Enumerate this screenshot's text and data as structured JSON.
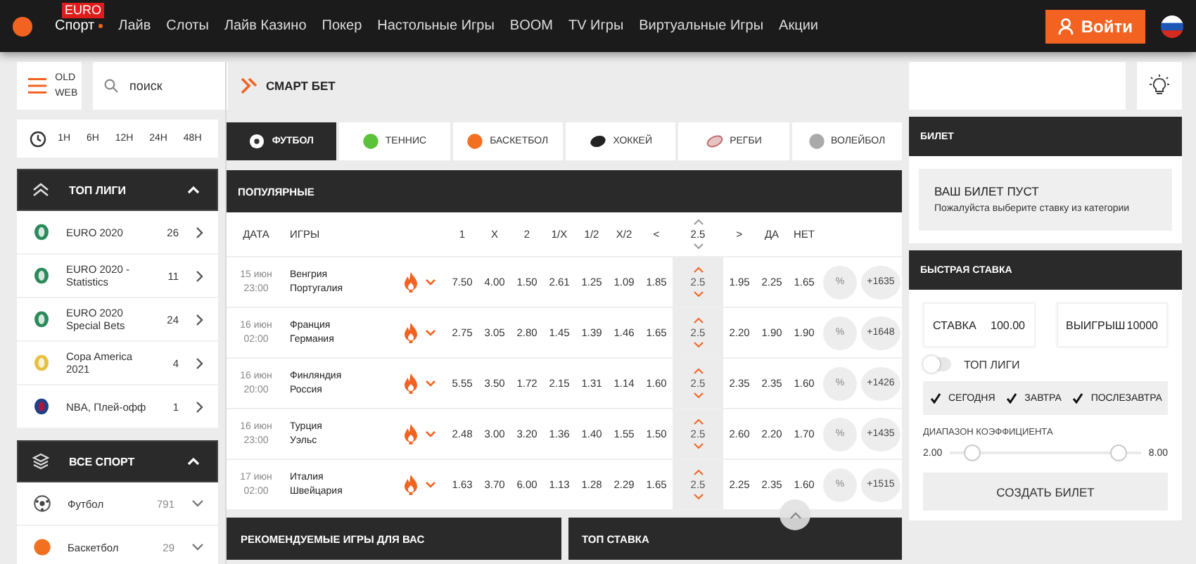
{
  "nav": {
    "badge": "EURO",
    "items": [
      {
        "label": "Спорт",
        "selected": true
      },
      {
        "label": "Лайв",
        "selected": false
      },
      {
        "label": "Слоты",
        "selected": false
      },
      {
        "label": "Лайв Казино",
        "selected": false
      },
      {
        "label": "Покер",
        "selected": false
      },
      {
        "label": "Настольные Игры",
        "selected": false
      },
      {
        "label": "BOOM",
        "selected": false
      },
      {
        "label": "TV Игры",
        "selected": false
      },
      {
        "label": "Виртуальные Игры",
        "selected": false
      },
      {
        "label": "Акции",
        "selected": false
      }
    ],
    "login": "Войти"
  },
  "left": {
    "old_web": "OLD WEB",
    "search": {
      "placeholder": "поиск"
    },
    "time_filters": [
      "1H",
      "6H",
      "12H",
      "24H",
      "48H"
    ],
    "top_leagues": {
      "title": "ТОП ЛИГИ",
      "expanded": true,
      "items": [
        {
          "name": "EURO 2020",
          "count": "26",
          "kind": "euro"
        },
        {
          "name": "EURO 2020 - Statistics",
          "count": "11",
          "kind": "euro"
        },
        {
          "name": "EURO 2020 Special Bets",
          "count": "24",
          "kind": "euro"
        },
        {
          "name": "Copa America 2021",
          "count": "4",
          "kind": "copa"
        },
        {
          "name": "NBA, Плей-офф",
          "count": "1",
          "kind": "nba"
        }
      ]
    },
    "all_sports": {
      "title": "ВСЕ СПОРТ",
      "expanded": true,
      "items": [
        {
          "name": "Футбол",
          "count": "791",
          "kind": "football"
        },
        {
          "name": "Баскетбол",
          "count": "29",
          "kind": "basketball"
        }
      ]
    }
  },
  "main": {
    "smart_bet": "СМАРТ БЕТ",
    "sport_tabs": [
      {
        "label": "ФУТБОЛ",
        "kind": "football",
        "selected": true
      },
      {
        "label": "ТЕННИС",
        "kind": "tennis",
        "selected": false
      },
      {
        "label": "БАСКЕТБОЛ",
        "kind": "basketball",
        "selected": false
      },
      {
        "label": "ХОККЕЙ",
        "kind": "hockey",
        "selected": false
      },
      {
        "label": "РЕГБИ",
        "kind": "rugby",
        "selected": false
      },
      {
        "label": "ВОЛЕЙБОЛ",
        "kind": "volleyball",
        "selected": false
      }
    ],
    "popular": {
      "title": "ПОПУЛЯРНЫЕ",
      "columns": [
        "ДАТА",
        "ИГРЫ",
        "1",
        "X",
        "2",
        "1/X",
        "1/2",
        "X/2",
        "<",
        "2.5",
        ">",
        "ДА",
        "НЕТ"
      ],
      "rows": [
        {
          "date": "15 июн",
          "time": "23:00",
          "teams": [
            "Венгрия",
            "Португалия"
          ],
          "odds": [
            "7.50",
            "4.00",
            "1.50",
            "2.61",
            "1.25",
            "1.09",
            "1.85"
          ],
          "total": "2.5",
          "odds2": [
            "1.95",
            "2.25",
            "1.65"
          ],
          "percent": "%",
          "more": "+1635"
        },
        {
          "date": "16 июн",
          "time": "02:00",
          "teams": [
            "Франция",
            "Германия"
          ],
          "odds": [
            "2.75",
            "3.05",
            "2.80",
            "1.45",
            "1.39",
            "1.46",
            "1.65"
          ],
          "total": "2.5",
          "odds2": [
            "2.20",
            "1.90",
            "1.90"
          ],
          "percent": "%",
          "more": "+1648"
        },
        {
          "date": "16 июн",
          "time": "20:00",
          "teams": [
            "Финляндия",
            "Россия"
          ],
          "odds": [
            "5.55",
            "3.50",
            "1.72",
            "2.15",
            "1.31",
            "1.14",
            "1.60"
          ],
          "total": "2.5",
          "odds2": [
            "2.35",
            "2.35",
            "1.60"
          ],
          "percent": "%",
          "more": "+1426"
        },
        {
          "date": "16 июн",
          "time": "23:00",
          "teams": [
            "Турция",
            "Уэльс"
          ],
          "odds": [
            "2.48",
            "3.00",
            "3.20",
            "1.36",
            "1.40",
            "1.55",
            "1.50"
          ],
          "total": "2.5",
          "odds2": [
            "2.60",
            "2.20",
            "1.70"
          ],
          "percent": "%",
          "more": "+1435"
        },
        {
          "date": "17 июн",
          "time": "02:00",
          "teams": [
            "Италия",
            "Швейцария"
          ],
          "odds": [
            "1.63",
            "3.70",
            "6.00",
            "1.13",
            "1.28",
            "2.29",
            "1.65"
          ],
          "total": "2.5",
          "odds2": [
            "2.25",
            "2.35",
            "1.60"
          ],
          "percent": "%",
          "more": "+1515"
        }
      ]
    },
    "sections": [
      "РЕКОМЕНДУЕМЫЕ ИГРЫ ДЛЯ ВАС",
      "ТОП СТАВКА"
    ]
  },
  "right": {
    "bet_slip": {
      "title": "БИЛЕТ",
      "empty_title": "ВАШ БИЛЕТ ПУСТ",
      "empty_text": "Пожалуйста выберите ставку из категории"
    },
    "quick_bet": {
      "title": "БЫСТРАЯ СТАВКА",
      "stake_label": "СТАВКА",
      "stake": "100.00",
      "win_label": "ВЫИГРЫШ",
      "win": "10000",
      "toggle": {
        "label": "ТОП ЛИГИ",
        "on": false
      },
      "days": [
        {
          "label": "СЕГОДНЯ",
          "checked": true
        },
        {
          "label": "ЗАВТРА",
          "checked": true
        },
        {
          "label": "ПОСЛЕЗАВТРА",
          "checked": true
        }
      ],
      "range_label": "ДИАПАЗОН КОЭФФИЦИЕНТА",
      "range_min": "2.00",
      "range_max": "8.00",
      "handles": [
        {
          "level": 0.12
        },
        {
          "level": 0.88
        }
      ],
      "create": "СОЗДАТЬ БИЛЕТ"
    }
  }
}
